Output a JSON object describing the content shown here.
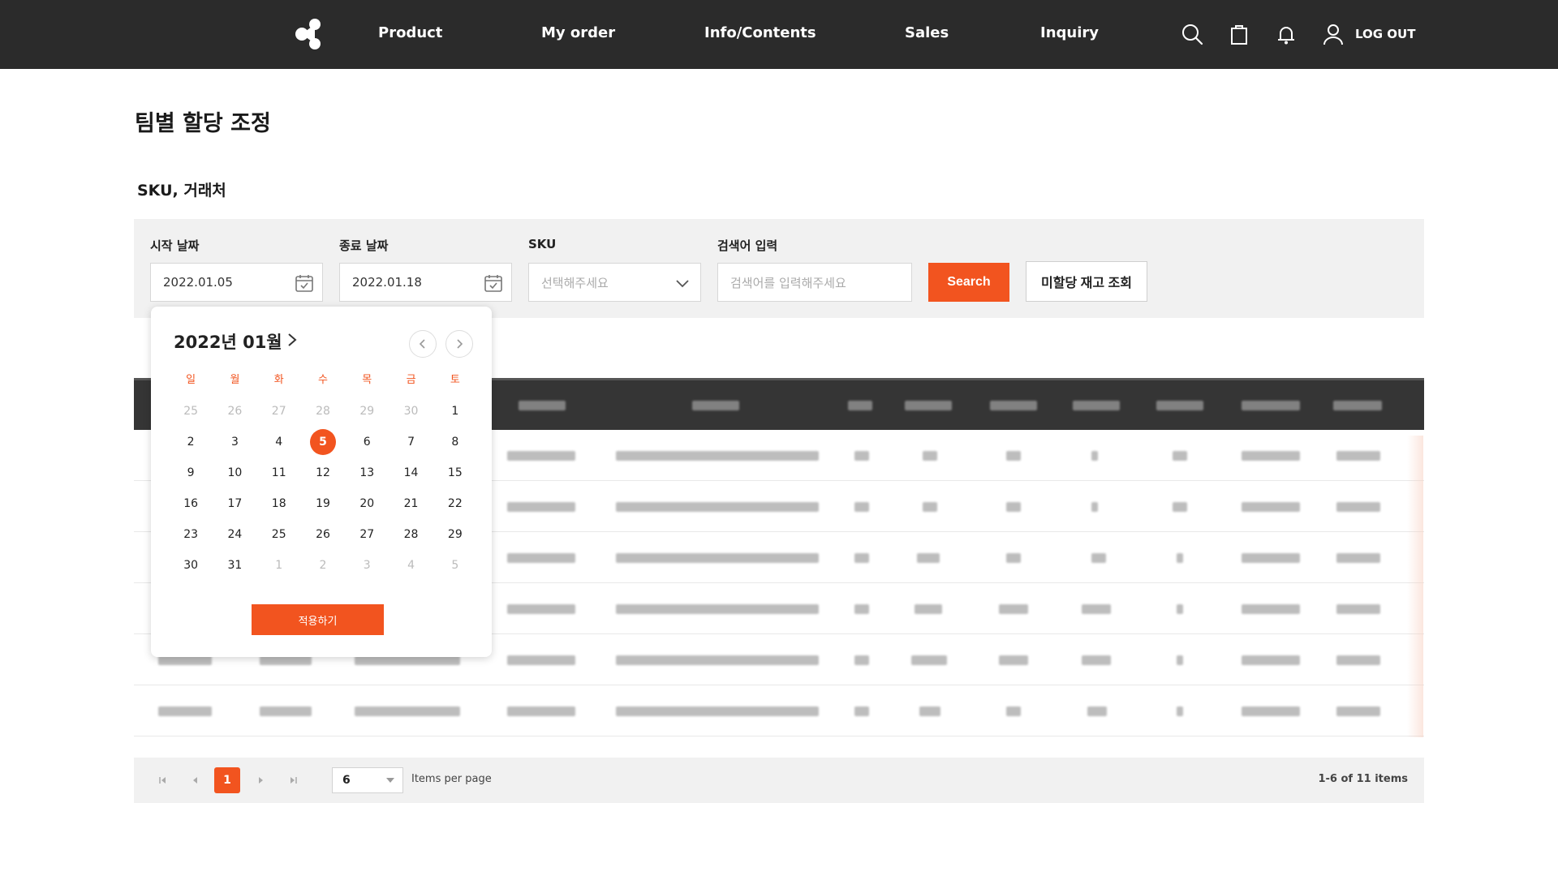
{
  "nav": {
    "items": [
      "Product",
      "My order",
      "Info/Contents",
      "Sales",
      "Inquiry"
    ],
    "logout_label": "LOG OUT"
  },
  "page": {
    "title": "팀별 할당 조정",
    "section_title": "SKU, 거래처"
  },
  "filters": {
    "start_label": "시작 날짜",
    "start_value": "2022.01.05",
    "end_label": "종료 날짜",
    "end_value": "2022.01.18",
    "sku_label": "SKU",
    "sku_placeholder": "선택해주세요",
    "keyword_label": "검색어 입력",
    "keyword_placeholder": "검색어를 입력해주세요",
    "search_label": "Search",
    "unallocated_label": "미할당 재고 조회"
  },
  "calendar": {
    "title": "2022년 01월",
    "weekdays": [
      "일",
      "월",
      "화",
      "수",
      "목",
      "금",
      "토"
    ],
    "weeks": [
      [
        "25",
        "26",
        "27",
        "28",
        "29",
        "30",
        "1"
      ],
      [
        "2",
        "3",
        "4",
        "5",
        "6",
        "7",
        "8"
      ],
      [
        "9",
        "10",
        "11",
        "12",
        "13",
        "14",
        "15"
      ],
      [
        "16",
        "17",
        "18",
        "19",
        "20",
        "21",
        "22"
      ],
      [
        "23",
        "24",
        "25",
        "26",
        "27",
        "28",
        "29"
      ],
      [
        "30",
        "31",
        "1",
        "2",
        "3",
        "4",
        "5"
      ]
    ],
    "selected_day": "5",
    "apply_label": "적용하기"
  },
  "pagination": {
    "current_page": "1",
    "per_page": "6",
    "per_page_label": "Items per page",
    "count_label": "1-6 of 11 items"
  },
  "colors": {
    "accent": "#f2541f",
    "topbar": "#2b2b2b",
    "table_header": "#353535"
  },
  "icons": {
    "nav": [
      "search-icon",
      "shopping-bag-icon",
      "bell-icon",
      "user-icon"
    ]
  }
}
